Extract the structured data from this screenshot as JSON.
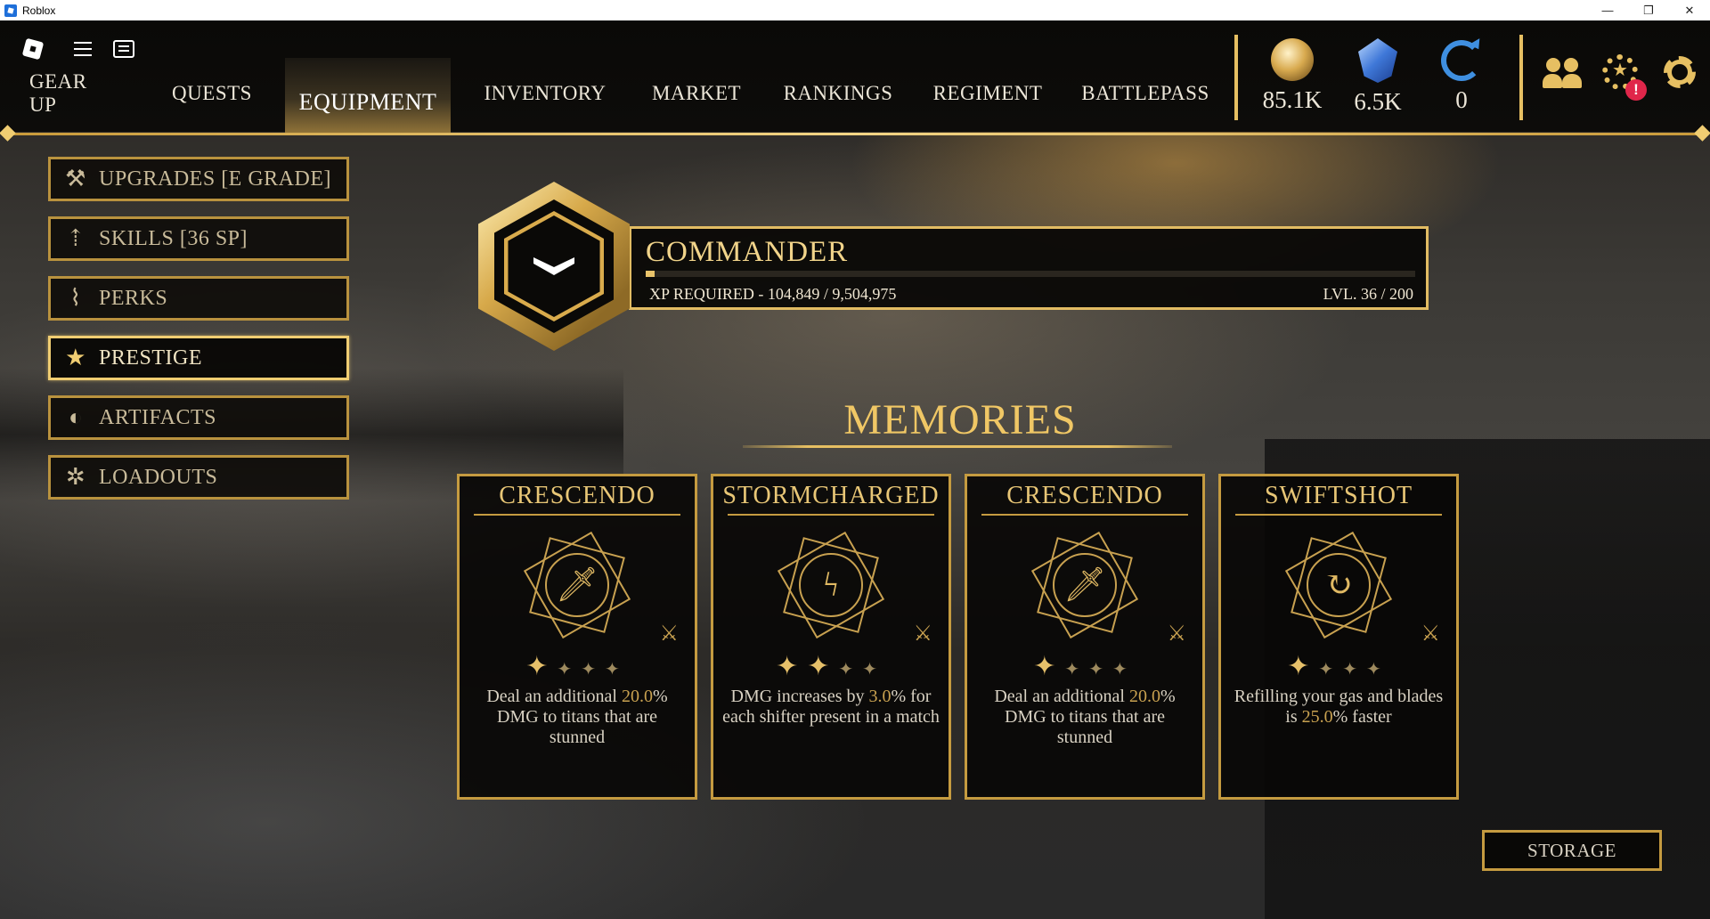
{
  "window": {
    "title": "Roblox",
    "controls": [
      "—",
      "❐",
      "✕"
    ]
  },
  "nav": {
    "tabs": [
      {
        "label": "GEAR UP"
      },
      {
        "label": "QUESTS"
      },
      {
        "label": "EQUIPMENT",
        "active": true
      },
      {
        "label": "INVENTORY"
      },
      {
        "label": "MARKET"
      },
      {
        "label": "RANKINGS"
      },
      {
        "label": "REGIMENT"
      },
      {
        "label": "BATTLEPASS"
      }
    ],
    "currencies": [
      {
        "icon": "gold-coin-icon",
        "value": "85.1K"
      },
      {
        "icon": "crystal-gem-icon",
        "value": "6.5K"
      },
      {
        "icon": "refresh-icon",
        "value": "0"
      }
    ],
    "notification_alert": "!"
  },
  "sidebar": {
    "items": [
      {
        "label": "UPGRADES [E GRADE]",
        "icon": "anvil-icon"
      },
      {
        "label": "SKILLS [36 SP]",
        "icon": "skills-icon"
      },
      {
        "label": "PERKS",
        "icon": "dna-icon"
      },
      {
        "label": "PRESTIGE",
        "icon": "prestige-chevrons-icon",
        "active": true
      },
      {
        "label": "ARTIFACTS",
        "icon": "artifact-icon"
      },
      {
        "label": "LOADOUTS",
        "icon": "loadout-gear-icon"
      }
    ]
  },
  "prestige": {
    "rank": "COMMANDER",
    "xp_label": "XP REQUIRED - 104,849 / 9,504,975",
    "xp_progress": 0.011,
    "level_label": "LVL. 36 / 200"
  },
  "memories": {
    "title": "MEMORIES",
    "cards": [
      {
        "title": "CRESCENDO",
        "icon": "sword-burst-icon",
        "stars_filled": 1,
        "stars_total": 4,
        "desc_pre": "Deal an additional ",
        "desc_hl": "20.0",
        "desc_post": "% DMG to titans that are stunned"
      },
      {
        "title": "STORMCHARGED",
        "icon": "lightning-sword-icon",
        "stars_filled": 2,
        "stars_total": 4,
        "desc_pre": "DMG increases by ",
        "desc_hl": "3.0",
        "desc_post": "% for each shifter present in a match"
      },
      {
        "title": "CRESCENDO",
        "icon": "sword-burst-icon",
        "stars_filled": 1,
        "stars_total": 4,
        "desc_pre": "Deal an additional ",
        "desc_hl": "20.0",
        "desc_post": "% DMG to titans that are stunned"
      },
      {
        "title": "SWIFTSHOT",
        "icon": "reload-arrow-icon",
        "stars_filled": 1,
        "stars_total": 4,
        "desc_pre": "Refilling your gas and blades is ",
        "desc_hl": "25.0",
        "desc_post": "% faster"
      }
    ]
  },
  "storage": {
    "label": "STORAGE"
  }
}
